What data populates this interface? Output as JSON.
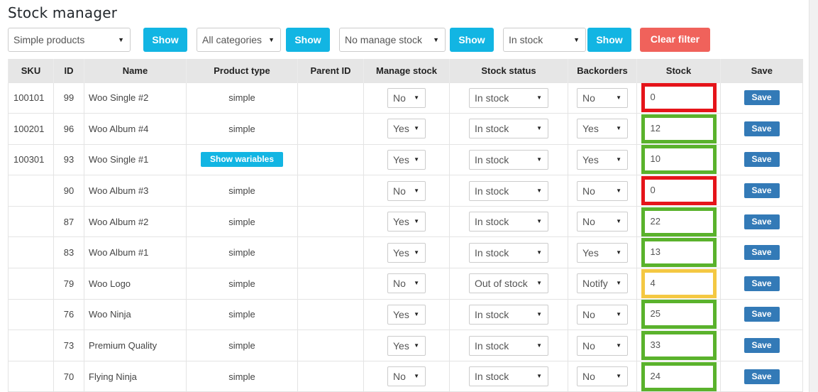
{
  "page": {
    "title": "Stock manager"
  },
  "filters": {
    "product_type": "Simple products",
    "category": "All categories",
    "manage_stock": "No manage stock",
    "stock_status": "In stock",
    "show_label": "Show",
    "clear_label": "Clear filter"
  },
  "colors": {
    "show_button": "#12b5e3",
    "clear_button": "#f0625b",
    "save_button": "#337ab7",
    "stock_ok": "#5ab22c",
    "stock_zero": "#e5141a",
    "stock_low": "#f4c842"
  },
  "table": {
    "headers": {
      "sku": "SKU",
      "id": "ID",
      "name": "Name",
      "product_type": "Product type",
      "parent_id": "Parent ID",
      "manage_stock": "Manage stock",
      "stock_status": "Stock status",
      "backorders": "Backorders",
      "stock": "Stock",
      "save": "Save"
    },
    "save_label": "Save",
    "variables_label": "Show wariables",
    "rows": [
      {
        "sku": "100101",
        "id": "99",
        "name": "Woo Single #2",
        "product_type": "simple",
        "parent_id": "",
        "manage_stock": "No",
        "stock_status": "In stock",
        "backorders": "No",
        "stock": "0",
        "stock_level": "red"
      },
      {
        "sku": "100201",
        "id": "96",
        "name": "Woo Album #4",
        "product_type": "simple",
        "parent_id": "",
        "manage_stock": "Yes",
        "stock_status": "In stock",
        "backorders": "Yes",
        "stock": "12",
        "stock_level": "green"
      },
      {
        "sku": "100301",
        "id": "93",
        "name": "Woo Single #1",
        "product_type": "variable",
        "parent_id": "",
        "manage_stock": "Yes",
        "stock_status": "In stock",
        "backorders": "Yes",
        "stock": "10",
        "stock_level": "green"
      },
      {
        "sku": "",
        "id": "90",
        "name": "Woo Album #3",
        "product_type": "simple",
        "parent_id": "",
        "manage_stock": "No",
        "stock_status": "In stock",
        "backorders": "No",
        "stock": "0",
        "stock_level": "red"
      },
      {
        "sku": "",
        "id": "87",
        "name": "Woo Album #2",
        "product_type": "simple",
        "parent_id": "",
        "manage_stock": "Yes",
        "stock_status": "In stock",
        "backorders": "No",
        "stock": "22",
        "stock_level": "green"
      },
      {
        "sku": "",
        "id": "83",
        "name": "Woo Album #1",
        "product_type": "simple",
        "parent_id": "",
        "manage_stock": "Yes",
        "stock_status": "In stock",
        "backorders": "Yes",
        "stock": "13",
        "stock_level": "green"
      },
      {
        "sku": "",
        "id": "79",
        "name": "Woo Logo",
        "product_type": "simple",
        "parent_id": "",
        "manage_stock": "No",
        "stock_status": "Out of stock",
        "backorders": "Notify",
        "stock": "4",
        "stock_level": "yellow"
      },
      {
        "sku": "",
        "id": "76",
        "name": "Woo Ninja",
        "product_type": "simple",
        "parent_id": "",
        "manage_stock": "Yes",
        "stock_status": "In stock",
        "backorders": "No",
        "stock": "25",
        "stock_level": "green"
      },
      {
        "sku": "",
        "id": "73",
        "name": "Premium Quality",
        "product_type": "simple",
        "parent_id": "",
        "manage_stock": "Yes",
        "stock_status": "In stock",
        "backorders": "No",
        "stock": "33",
        "stock_level": "green"
      },
      {
        "sku": "",
        "id": "70",
        "name": "Flying Ninja",
        "product_type": "simple",
        "parent_id": "",
        "manage_stock": "No",
        "stock_status": "In stock",
        "backorders": "No",
        "stock": "24",
        "stock_level": "green"
      }
    ]
  }
}
